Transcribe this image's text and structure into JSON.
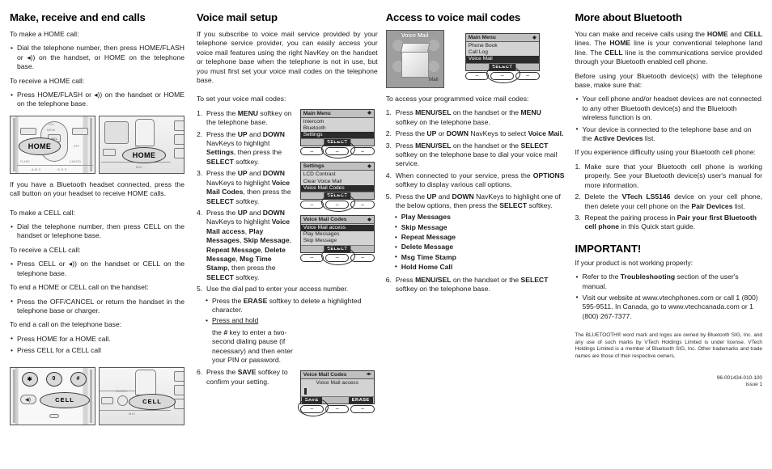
{
  "col1": {
    "title": "Make, receive and end calls",
    "p_make_home": "To make a HOME call:",
    "b_make_home": "Dial the telephone number, then press HOME/FLASH or ◂)) on the handset, or HOME on the telephone base.",
    "p_recv_home": "To receive a HOME call:",
    "b_recv_home": "Press HOME/FLASH or ◂)) on the handset or HOME on the telephone base.",
    "p_bt_headset": "If you have a Bluetooth headset connected, press the call button on your headset to receive HOME calls.",
    "p_make_cell": "To make a CELL call:",
    "b_make_cell": "Dial the telephone number, then press CELL on the handset or telephone base.",
    "p_recv_cell": "To receive a CELL call:",
    "b_recv_cell": "Press CELL or ◂)) on the handset or CELL on the telephone base.",
    "p_end_hs": "To end a HOME or CELL call on the handset:",
    "b_end_hs": "Press the OFF/CANCEL or return the handset in the telephone base or charger.",
    "p_end_base": "To end a call on the telephone base:",
    "b_end_base_1": "Press HOME for a HOME call.",
    "b_end_base_2": "Press CELL for a CELL call",
    "photo_home_handset_label": "HOME",
    "photo_home_base_label": "HOME",
    "photo_cell_handset_label": "CELL",
    "photo_cell_base_label": "CELL",
    "handset_keys": {
      "vol": "VOL",
      "menu": "MENU",
      "sel": "SEL",
      "off": "OFF",
      "flash": "FLASH",
      "cancel": "CANCEL",
      "abc": "A B C",
      "def": "D E F"
    },
    "dialpad": {
      "star": "✱",
      "zero": "0",
      "hash": "#"
    }
  },
  "col2": {
    "title": "Voice mail setup",
    "intro": "If you subscribe to voice mail service provided by your telephone service provider, you can easily access your voice mail features using the right NavKey on the handset or telephone base when the telephone is not in use, but you must first set your voice mail codes on the telephone base.",
    "lead": "To set your voice mail codes:",
    "steps": [
      "Press the MENU softkey on the telephone base.",
      "Press the UP and DOWN NavKeys to highlight Settings, then press the SELECT softkey.",
      "Press the UP and DOWN NavKeys to highlight Voice Mail Codes, then press the SELECT softkey.",
      "Press the UP and DOWN NavKeys to highlight Voice Mail access, Play Messages, Skip Message, Repeat Message, Delete Message, Msg Time Stamp, then press the SELECT softkey.",
      "Use the dial pad to enter your access number.",
      "Press the SAVE softkey to confirm your setting."
    ],
    "sub_step5": [
      "Press the ERASE softkey to delete a highlighted character.",
      "Press and hold the # key to enter a two-second dialing pause (if necessary) and then enter your PIN or password."
    ],
    "lcd_main_menu": {
      "title": "Main Menu",
      "items": [
        "Intercom",
        "Bluetooth",
        "Settings"
      ],
      "highlight": "Settings",
      "softkey": "SELECT"
    },
    "lcd_settings": {
      "title": "Settings",
      "items": [
        "LCD Contrast",
        "Clear Voice Mail",
        "Voice Mail Codes"
      ],
      "highlight": "Voice Mail Codes",
      "softkey": "SELECT"
    },
    "lcd_vm_codes": {
      "title": "Voice Mail Codes",
      "items": [
        "Voice Mail access",
        "Play Messages",
        "Skip Message"
      ],
      "highlight": "Voice Mail access",
      "softkey": "SELECT"
    },
    "lcd_vm_entry": {
      "title": "Voice Mail Codes",
      "subtitle": "Voice Mail access",
      "softkey_left": "SAVE",
      "softkey_right": "ERASE"
    }
  },
  "col3": {
    "title": "Access to voice mail codes",
    "art_label": "Voice Mail",
    "art_mail": "Mail",
    "lcd_main_menu": {
      "title": "Main Menu",
      "items": [
        "Phone Book",
        "Call Log",
        "Voice Mail"
      ],
      "highlight": "Voice Mail",
      "softkey": "SELECT"
    },
    "lead": "To access your programmed voice mail codes:",
    "steps": [
      "Press MENU/SEL on the handset or the MENU softkey on the telephone base.",
      "Press the UP or DOWN NavKeys to select Voice Mail.",
      "Press MENU/SEL on the handset or the SELECT softkey on the telephone base to dial your voice mail service.",
      "When connected to your service, press the OPTIONS softkey to display various call options.",
      "Press the UP and DOWN NavKeys to highlight one of the below options, then press the SELECT softkey.",
      "Press MENU/SEL on the handset or the SELECT softkey on the telephone base."
    ],
    "options": [
      "Play Messages",
      "Skip Message",
      "Repeat Message",
      "Delete Message",
      "Msg Time Stamp",
      "Hold Home Call"
    ]
  },
  "col4": {
    "title": "More about Bluetooth",
    "p1": "You can make and receive calls using the HOME and CELL lines. The HOME line is your conventional telephone land line. The CELL line is the communications service provided through your Bluetooth enabled cell phone.",
    "p2": "Before using your Bluetooth device(s) with the telephone base, make sure that:",
    "bullets": [
      "Your cell phone and/or headset devices are not connected to any other Bluetooth device(s) and the Bluetooth wireless function is on.",
      "Your device is connected to the telephone base and on the Active Devices list."
    ],
    "p3": "If you experience difficulty using your Bluetooth cell phone:",
    "steps": [
      "Make sure that your Bluetooth cell phone is working properly. See your Bluetooth device(s) user's manual for more information.",
      "Delete the VTech LS5146 device on your cell phone, then delete your cell phone on the Pair Devices list.",
      "Repeat the pairing process in Pair your first Bluetooth cell phone in this Quick start guide."
    ],
    "important_title": "IMPORTANT!",
    "important_lead": "If your product is not working properly:",
    "important_bullets": [
      "Refer to the Troubleshooting section of the user's manual.",
      "Visit our website at www.vtechphones.com or call 1 (800) 595-9511. In Canada, go to www.vtechcanada.com or 1 (800) 267-7377."
    ],
    "trademark": "The BLUETOOTH® word mark and logos are owned by Bluetooth SIG, Inc. and any use of such marks by VTech Holdings Limited is under license. VTech Holdings Limited is a member of Bluetooth SIG, Inc. Other trademarks and trade names are those of their respective owners.",
    "part_number": "96-001434-010-100",
    "issue": "issue 1"
  }
}
